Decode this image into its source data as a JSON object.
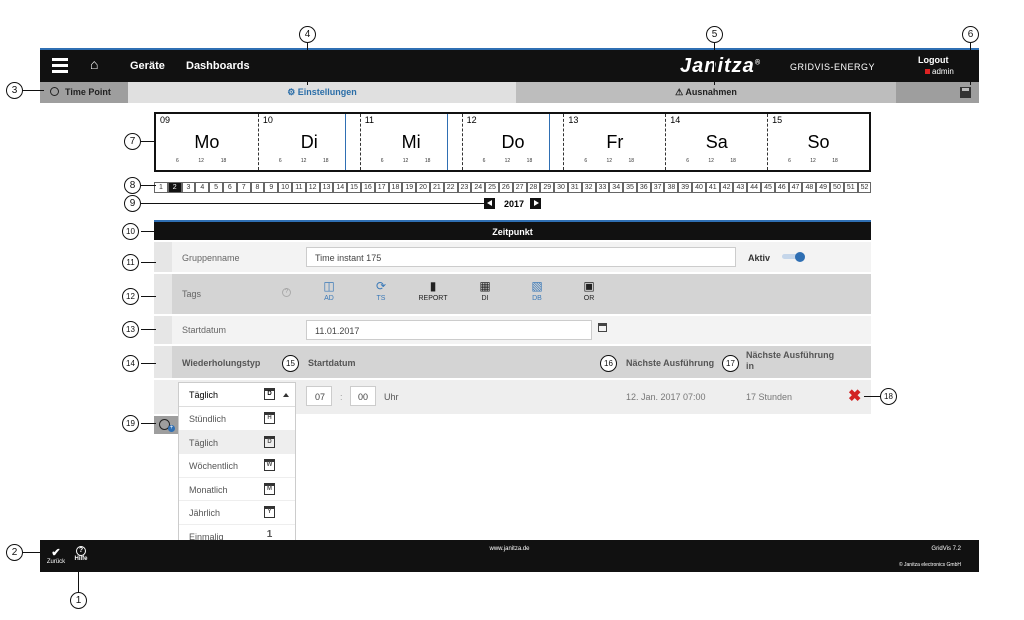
{
  "header": {
    "home_icon": "home-icon",
    "nav": [
      "Geräte",
      "Dashboards"
    ],
    "logo": "Janitza",
    "logo_mark": "®",
    "gridvis": "GRIDVIS-ENERGY",
    "logout": "Logout",
    "user": "admin"
  },
  "tabs": {
    "timepoint": "Time Point",
    "einstellungen": "Einstellungen",
    "ausnahmen": "Ausnahmen"
  },
  "week": {
    "days": [
      {
        "num": "09",
        "name": "Mo"
      },
      {
        "num": "10",
        "name": "Di"
      },
      {
        "num": "11",
        "name": "Mi"
      },
      {
        "num": "12",
        "name": "Do"
      },
      {
        "num": "13",
        "name": "Fr"
      },
      {
        "num": "14",
        "name": "Sa"
      },
      {
        "num": "15",
        "name": "So"
      }
    ],
    "ticks": [
      "6",
      "12",
      "18"
    ]
  },
  "week_numbers": [
    "1",
    "2",
    "3",
    "4",
    "5",
    "6",
    "7",
    "8",
    "9",
    "10",
    "11",
    "12",
    "13",
    "14",
    "15",
    "16",
    "17",
    "18",
    "19",
    "20",
    "21",
    "22",
    "23",
    "24",
    "25",
    "26",
    "27",
    "28",
    "29",
    "30",
    "31",
    "32",
    "33",
    "34",
    "35",
    "36",
    "37",
    "38",
    "39",
    "40",
    "41",
    "42",
    "43",
    "44",
    "45",
    "46",
    "47",
    "48",
    "49",
    "50",
    "51",
    "52"
  ],
  "active_week": "2",
  "year": "2017",
  "panel": {
    "title": "Zeitpunkt",
    "gruppenname_label": "Gruppenname",
    "gruppenname_value": "Time instant 175",
    "aktiv_label": "Aktiv",
    "tags_label": "Tags",
    "tags": [
      {
        "label": "AD",
        "icon": "ad-icon",
        "color": "blue"
      },
      {
        "label": "TS",
        "icon": "ts-icon",
        "color": "blue"
      },
      {
        "label": "REPORT",
        "icon": "report-icon",
        "color": "dark"
      },
      {
        "label": "DI",
        "icon": "di-icon",
        "color": "dark"
      },
      {
        "label": "DB",
        "icon": "db-icon",
        "color": "blue"
      },
      {
        "label": "OR",
        "icon": "or-icon",
        "color": "dark"
      }
    ],
    "startdatum_label": "Startdatum",
    "startdatum_value": "11.01.2017",
    "col_wiederholungstyp": "Wiederholungstyp",
    "col_startdatum": "Startdatum",
    "col_naechste": "Nächste Ausführung",
    "col_naechste_in": "Nächste Ausführung in",
    "hour": "07",
    "sep": ":",
    "minute": "00",
    "uhr": "Uhr",
    "next_exec": "12. Jan. 2017 07:00",
    "next_in": "17 Stunden"
  },
  "dropdown": {
    "selected": "Täglich",
    "selected_letter": "D",
    "options": [
      {
        "label": "Stündlich",
        "letter": "H"
      },
      {
        "label": "Täglich",
        "letter": "D"
      },
      {
        "label": "Wöchentlich",
        "letter": "W"
      },
      {
        "label": "Monatlich",
        "letter": "M"
      },
      {
        "label": "Jährlich",
        "letter": "Y"
      },
      {
        "label": "Einmalig",
        "letter": "1"
      }
    ]
  },
  "footer": {
    "url": "www.janitza.de",
    "version": "GridVis 7.2",
    "copyright": "© Janitza electronics GmbH",
    "back": "Zurück",
    "help": "Hilfe"
  },
  "callouts": [
    "1",
    "2",
    "3",
    "4",
    "5",
    "6",
    "7",
    "8",
    "9",
    "10",
    "11",
    "12",
    "13",
    "14",
    "15",
    "16",
    "17",
    "18",
    "19"
  ],
  "colors": {
    "accent": "#2f6fb3",
    "delete": "#d22222",
    "dark": "#111111"
  }
}
